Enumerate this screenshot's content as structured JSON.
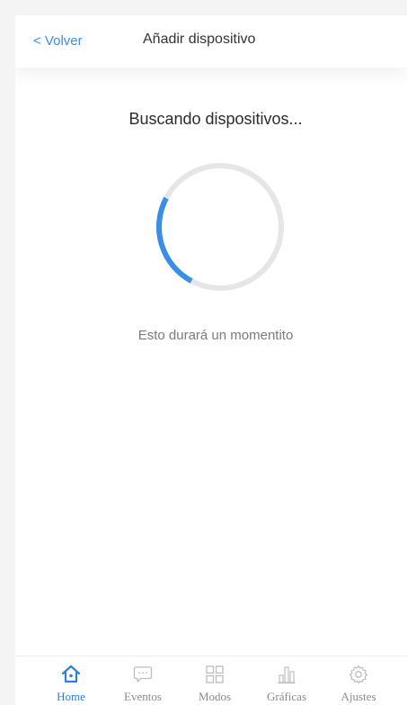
{
  "header": {
    "back_label": "< Volver",
    "title": "Añadir dispositivo"
  },
  "main": {
    "searching_title": "Buscando dispositivos...",
    "spinner_progress": 0.25,
    "subtitle": "Esto durará un momentito"
  },
  "tabbar": {
    "tabs": [
      {
        "label": "Home",
        "icon": "home-icon",
        "active": true
      },
      {
        "label": "Eventos",
        "icon": "chat-bubble-icon",
        "active": false
      },
      {
        "label": "Modos",
        "icon": "grid-icon",
        "active": false
      },
      {
        "label": "Gráficas",
        "icon": "bar-chart-icon",
        "active": false
      },
      {
        "label": "Ajustes",
        "icon": "gear-icon",
        "active": false
      }
    ]
  },
  "colors": {
    "accent": "#2f7fd8",
    "link": "#3b8ee8",
    "spinner_track": "#e6e6e6",
    "spinner_arc": "#3b8ee8",
    "inactive_icon": "#bdbdbd"
  }
}
